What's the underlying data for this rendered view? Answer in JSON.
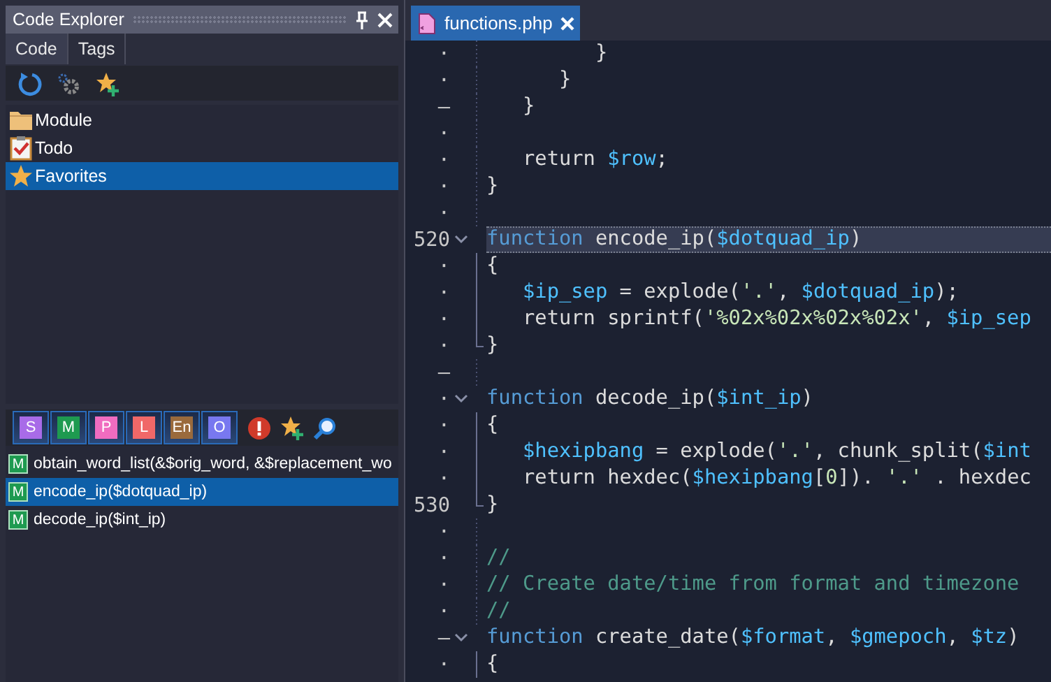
{
  "explorer": {
    "title": "Code Explorer",
    "tabs": [
      {
        "label": "Code",
        "selected": true
      },
      {
        "label": "Tags",
        "selected": false
      }
    ],
    "toolbar": [
      {
        "kind": "refresh"
      },
      {
        "kind": "options"
      },
      {
        "kind": "add-favorite"
      }
    ],
    "tree": [
      {
        "kind": "folder",
        "label": "Module",
        "selected": false
      },
      {
        "kind": "todo",
        "label": "Todo",
        "selected": false
      },
      {
        "kind": "star",
        "label": "Favorites",
        "selected": true
      }
    ],
    "filters": [
      {
        "label": "S",
        "color": "#a86be8",
        "on": true
      },
      {
        "label": "M",
        "color": "#1e9a50",
        "on": true
      },
      {
        "label": "P",
        "color": "#f06cc0",
        "on": true
      },
      {
        "label": "L",
        "color": "#f06868",
        "on": true
      },
      {
        "label": "En",
        "color": "#9a6a3c",
        "on": true
      },
      {
        "label": "O",
        "color": "#7878f0",
        "on": true
      }
    ],
    "filter_tools": [
      {
        "kind": "error"
      },
      {
        "kind": "add-favorite"
      },
      {
        "kind": "search"
      }
    ],
    "members": [
      {
        "badge": "M",
        "label": "obtain_word_list(&$orig_word, &$replacement_wo",
        "selected": false
      },
      {
        "badge": "M",
        "label": "encode_ip($dotquad_ip)",
        "selected": true
      },
      {
        "badge": "M",
        "label": "decode_ip($int_ip)",
        "selected": false
      }
    ]
  },
  "editor": {
    "tabs": [
      {
        "label": "functions.php",
        "selected": true
      }
    ],
    "lines": [
      {
        "gutter": "·",
        "kind": "plain",
        "tokens": [
          {
            "kind": "plain",
            "text": "         }"
          }
        ]
      },
      {
        "gutter": "·",
        "kind": "plain",
        "tokens": [
          {
            "kind": "plain",
            "text": "      }"
          }
        ]
      },
      {
        "gutter": "–",
        "kind": "plain",
        "tokens": [
          {
            "kind": "plain",
            "text": "   }"
          }
        ]
      },
      {
        "gutter": "·",
        "kind": "plain"
      },
      {
        "gutter": "·",
        "kind": "plain",
        "tokens": [
          {
            "kind": "plain",
            "text": "   return "
          },
          {
            "kind": "var",
            "text": "$row"
          },
          {
            "kind": "plain",
            "text": ";"
          }
        ]
      },
      {
        "gutter": "·",
        "kind": "plain",
        "tokens": [
          {
            "kind": "plain",
            "text": "}"
          }
        ]
      },
      {
        "gutter": "·",
        "kind": "plain"
      },
      {
        "gutter": "520",
        "kind": "fold-start",
        "current": true,
        "tokens": [
          {
            "kind": "keyword",
            "text": "function"
          },
          {
            "kind": "plain",
            "text": " encode_ip("
          },
          {
            "kind": "var",
            "text": "$dotquad_ip"
          },
          {
            "kind": "plain",
            "text": ")"
          }
        ]
      },
      {
        "gutter": "·",
        "kind": "fold-body",
        "tokens": [
          {
            "kind": "plain",
            "text": "{"
          }
        ]
      },
      {
        "gutter": "·",
        "kind": "fold-body",
        "tokens": [
          {
            "kind": "var",
            "text": "   $ip_sep"
          },
          {
            "kind": "plain",
            "text": " = explode("
          },
          {
            "kind": "string",
            "text": "'.'"
          },
          {
            "kind": "plain",
            "text": ", "
          },
          {
            "kind": "var",
            "text": "$dotquad_ip"
          },
          {
            "kind": "plain",
            "text": ");"
          }
        ]
      },
      {
        "gutter": "·",
        "kind": "fold-body",
        "tokens": [
          {
            "kind": "plain",
            "text": "   return sprintf("
          },
          {
            "kind": "string",
            "text": "'%02x%02x%02x%02x'"
          },
          {
            "kind": "plain",
            "text": ", "
          },
          {
            "kind": "var",
            "text": "$ip_sep"
          }
        ]
      },
      {
        "gutter": "·",
        "kind": "fold-end",
        "tokens": [
          {
            "kind": "plain",
            "text": "}"
          }
        ]
      },
      {
        "gutter": "–",
        "kind": "plain"
      },
      {
        "gutter": "·",
        "kind": "fold-start",
        "tokens": [
          {
            "kind": "keyword",
            "text": "function"
          },
          {
            "kind": "plain",
            "text": " decode_ip("
          },
          {
            "kind": "var",
            "text": "$int_ip"
          },
          {
            "kind": "plain",
            "text": ")"
          }
        ]
      },
      {
        "gutter": "·",
        "kind": "fold-body",
        "tokens": [
          {
            "kind": "plain",
            "text": "{"
          }
        ]
      },
      {
        "gutter": "·",
        "kind": "fold-body",
        "tokens": [
          {
            "kind": "var",
            "text": "   $hexipbang"
          },
          {
            "kind": "plain",
            "text": " = explode("
          },
          {
            "kind": "string",
            "text": "'.'"
          },
          {
            "kind": "plain",
            "text": ", chunk_split("
          },
          {
            "kind": "var",
            "text": "$int"
          }
        ]
      },
      {
        "gutter": "·",
        "kind": "fold-body",
        "tokens": [
          {
            "kind": "plain",
            "text": "   return hexdec("
          },
          {
            "kind": "var",
            "text": "$hexipbang"
          },
          {
            "kind": "plain",
            "text": "["
          },
          {
            "kind": "string",
            "text": "0"
          },
          {
            "kind": "plain",
            "text": "]). "
          },
          {
            "kind": "string",
            "text": "'.'"
          },
          {
            "kind": "plain",
            "text": " . hexdec"
          }
        ]
      },
      {
        "gutter": "530",
        "kind": "fold-end",
        "tokens": [
          {
            "kind": "plain",
            "text": "}"
          }
        ]
      },
      {
        "gutter": "·",
        "kind": "plain"
      },
      {
        "gutter": "·",
        "kind": "plain",
        "tokens": [
          {
            "kind": "comment",
            "text": "//"
          }
        ]
      },
      {
        "gutter": "·",
        "kind": "plain",
        "tokens": [
          {
            "kind": "comment",
            "text": "// Create date/time from format and timezone"
          }
        ]
      },
      {
        "gutter": "·",
        "kind": "plain",
        "tokens": [
          {
            "kind": "comment",
            "text": "//"
          }
        ]
      },
      {
        "gutter": "–",
        "kind": "fold-start",
        "tokens": [
          {
            "kind": "keyword",
            "text": "function"
          },
          {
            "kind": "plain",
            "text": " create_date("
          },
          {
            "kind": "var",
            "text": "$format"
          },
          {
            "kind": "plain",
            "text": ", "
          },
          {
            "kind": "var",
            "text": "$gmepoch"
          },
          {
            "kind": "plain",
            "text": ", "
          },
          {
            "kind": "var",
            "text": "$tz"
          },
          {
            "kind": "plain",
            "text": ")"
          }
        ]
      },
      {
        "gutter": "·",
        "kind": "fold-body",
        "tokens": [
          {
            "kind": "plain",
            "text": "{"
          }
        ]
      }
    ]
  }
}
